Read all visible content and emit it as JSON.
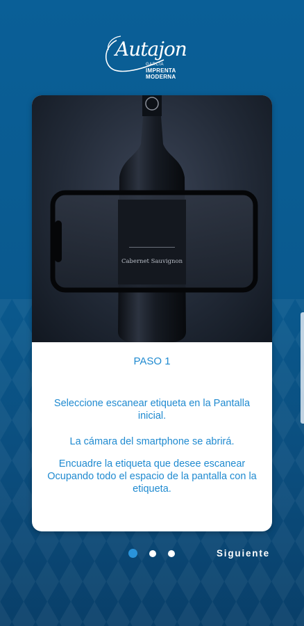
{
  "logo": {
    "script_text": "Autajon",
    "subtitle": "GARCIA",
    "main_text": "IMPRENTA MODERNA"
  },
  "card": {
    "illustration_label": "Cabernet Sauvignon",
    "step_title": "PASO 1",
    "paragraphs": [
      "Seleccione escanear etiqueta en la Pantalla inicial.",
      "La cámara del smartphone se abrirá.",
      "Encuadre la etiqueta que desee escanear Ocupando todo el espacio de la pantalla con la etiqueta."
    ]
  },
  "pager": {
    "total": 3,
    "current": 1
  },
  "next_button": {
    "label": "Siguiente"
  },
  "colors": {
    "background": "#0a5a8f",
    "accent_text": "#1f8ad0",
    "active_dot": "#2a93da"
  }
}
